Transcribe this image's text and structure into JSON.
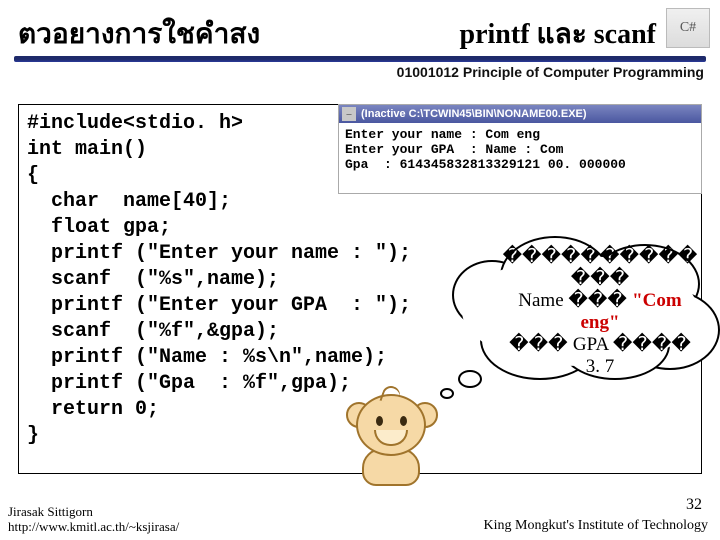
{
  "header": {
    "title_left": "ตวอยางการใชคำสง",
    "title_right": "printf และ scanf",
    "course": "01001012 Principle of Computer Programming",
    "logo_label": "C#"
  },
  "code": "#include<stdio. h>\nint main()\n{\n  char  name[40];\n  float gpa;\n  printf (\"Enter your name : \");\n  scanf  (\"%s\",name);\n  printf (\"Enter your GPA  : \");\n  scanf  (\"%f\",&gpa);\n  printf (\"Name : %s\\n\",name);\n  printf (\"Gpa  : %f\",gpa);\n  return 0;\n}",
  "console": {
    "window_title": "(Inactive C:\\TCWIN45\\BIN\\NONAME00.EXE)",
    "output": "Enter your name : Com eng\nEnter your GPA  : Name : Com\nGpa  : 614345832813329121 00. 000000"
  },
  "bubble": {
    "line1_placeholder": "����������",
    "line2_placeholder": "���",
    "line3_label": "Name ",
    "line3_placeholder": "��� ",
    "line3_value": "\"Com",
    "line4_value": "eng\"",
    "line5_label_pre": "��� ",
    "line5_label_mid": "GPA ",
    "line5_label_post": "����",
    "line6_value": "3. 7"
  },
  "footer": {
    "author": "Jirasak Sittigorn",
    "url": "http://www.kmitl.ac.th/~ksjirasa/",
    "institution": "King Mongkut's Institute of Technology",
    "page_number": "32"
  }
}
